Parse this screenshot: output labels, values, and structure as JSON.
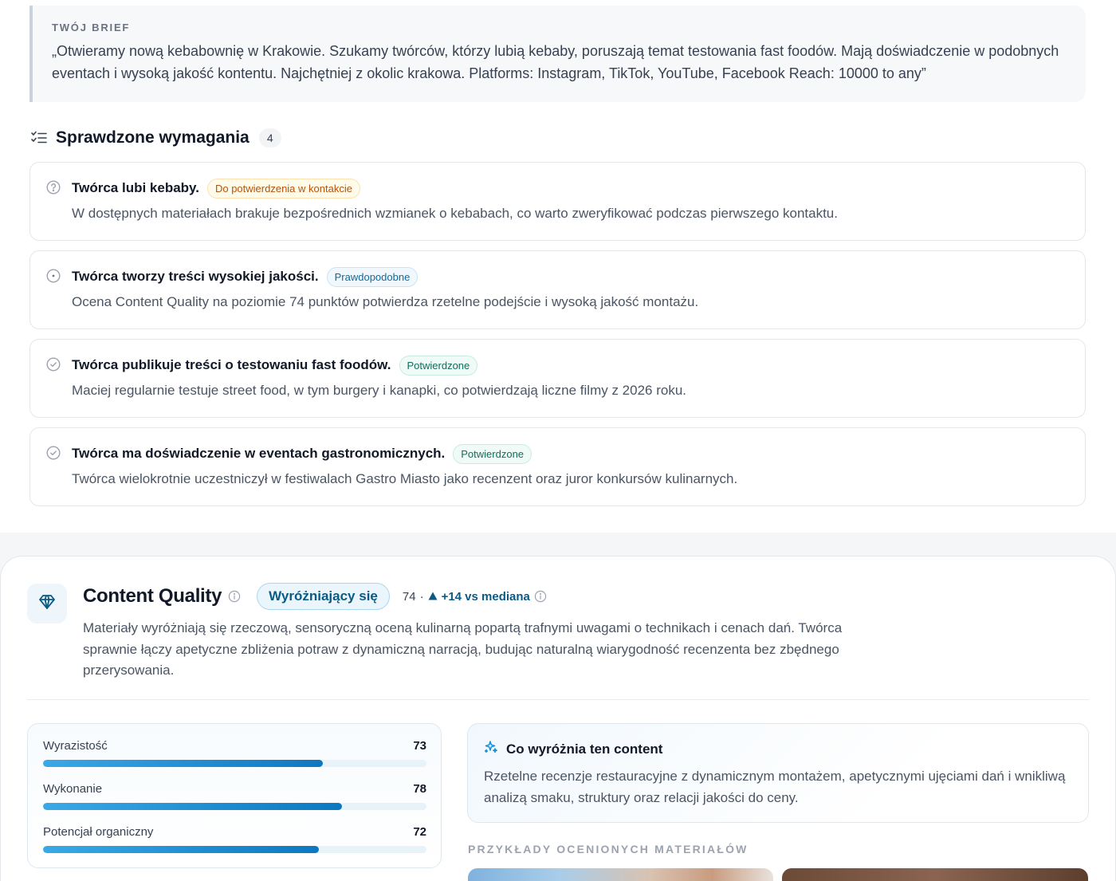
{
  "brief": {
    "label": "TWÓJ BRIEF",
    "text": "„Otwieramy nową kebabownię w Krakowie. Szukamy twórców, którzy lubią kebaby, poruszają temat testowania fast foodów. Mają doświadczenie w podobnych eventach i wysoką jakość kontentu. Najchętniej z okolic krakowa. Platforms: Instagram, TikTok, YouTube, Facebook Reach: 10000 to any”"
  },
  "requirements": {
    "title": "Sprawdzone wymagania",
    "count": "4",
    "items": [
      {
        "name": "Twórca lubi kebaby.",
        "badge": "Do potwierdzenia w kontakcie",
        "status_icon": "question-circle-icon",
        "description": "W dostępnych materiałach brakuje bezpośrednich wzmianek o kebabach, co warto zweryfikować podczas pierwszego kontaktu."
      },
      {
        "name": "Twórca tworzy treści wysokiej jakości.",
        "badge": "Prawdopodobne",
        "status_icon": "dot-circle-icon",
        "description": "Ocena Content Quality na poziomie 74 punktów potwierdza rzetelne podejście i wysoką jakość montażu."
      },
      {
        "name": "Twórca publikuje treści o testowaniu fast foodów.",
        "badge": "Potwierdzone",
        "status_icon": "check-circle-icon",
        "description": "Maciej regularnie testuje street food, w tym burgery i kanapki, co potwierdzają liczne filmy z 2026 roku."
      },
      {
        "name": "Twórca ma doświadczenie w eventach gastronomicznych.",
        "badge": "Potwierdzone",
        "status_icon": "check-circle-icon",
        "description": "Twórca wielokrotnie uczestniczył w festiwalach Gastro Miasto jako recenzent oraz juror konkursów kulinarnych."
      }
    ]
  },
  "content_quality": {
    "title": "Content Quality",
    "badge": "Wyróżniający się",
    "score": "74",
    "separator": "·",
    "delta": "+14 vs mediana",
    "description": "Materiały wyróżniają się rzeczową, sensoryczną oceną kulinarną popartą trafnymi uwagami o technikach i cenach dań. Twórca sprawnie łączy apetyczne zbliżenia potraw z dynamiczną narracją, budując naturalną wiarygodność recenzenta bez zbędnego przerysowania.",
    "metrics": [
      {
        "label": "Wyrazistość",
        "value": "73",
        "level": 0.73
      },
      {
        "label": "Wykonanie",
        "value": "78",
        "level": 0.78
      },
      {
        "label": "Potencjał organiczny",
        "value": "72",
        "level": 0.72
      }
    ],
    "highlight": {
      "title": "Co wyróżnia ten content",
      "text": "Rzetelne recenzje restauracyjne z dynamicznym montażem, apetycznymi ujęciami dań i wnikliwą analizą smaku, struktury oraz relacji jakości do ceny."
    },
    "examples_label": "PRZYKŁADY OCENIONYCH MATERIAŁÓW"
  },
  "colors": {
    "accent": "#0c78c2",
    "amber_badge": "#b45309",
    "blue_badge": "#0e6a9c",
    "green_badge": "#0f6e5c"
  }
}
